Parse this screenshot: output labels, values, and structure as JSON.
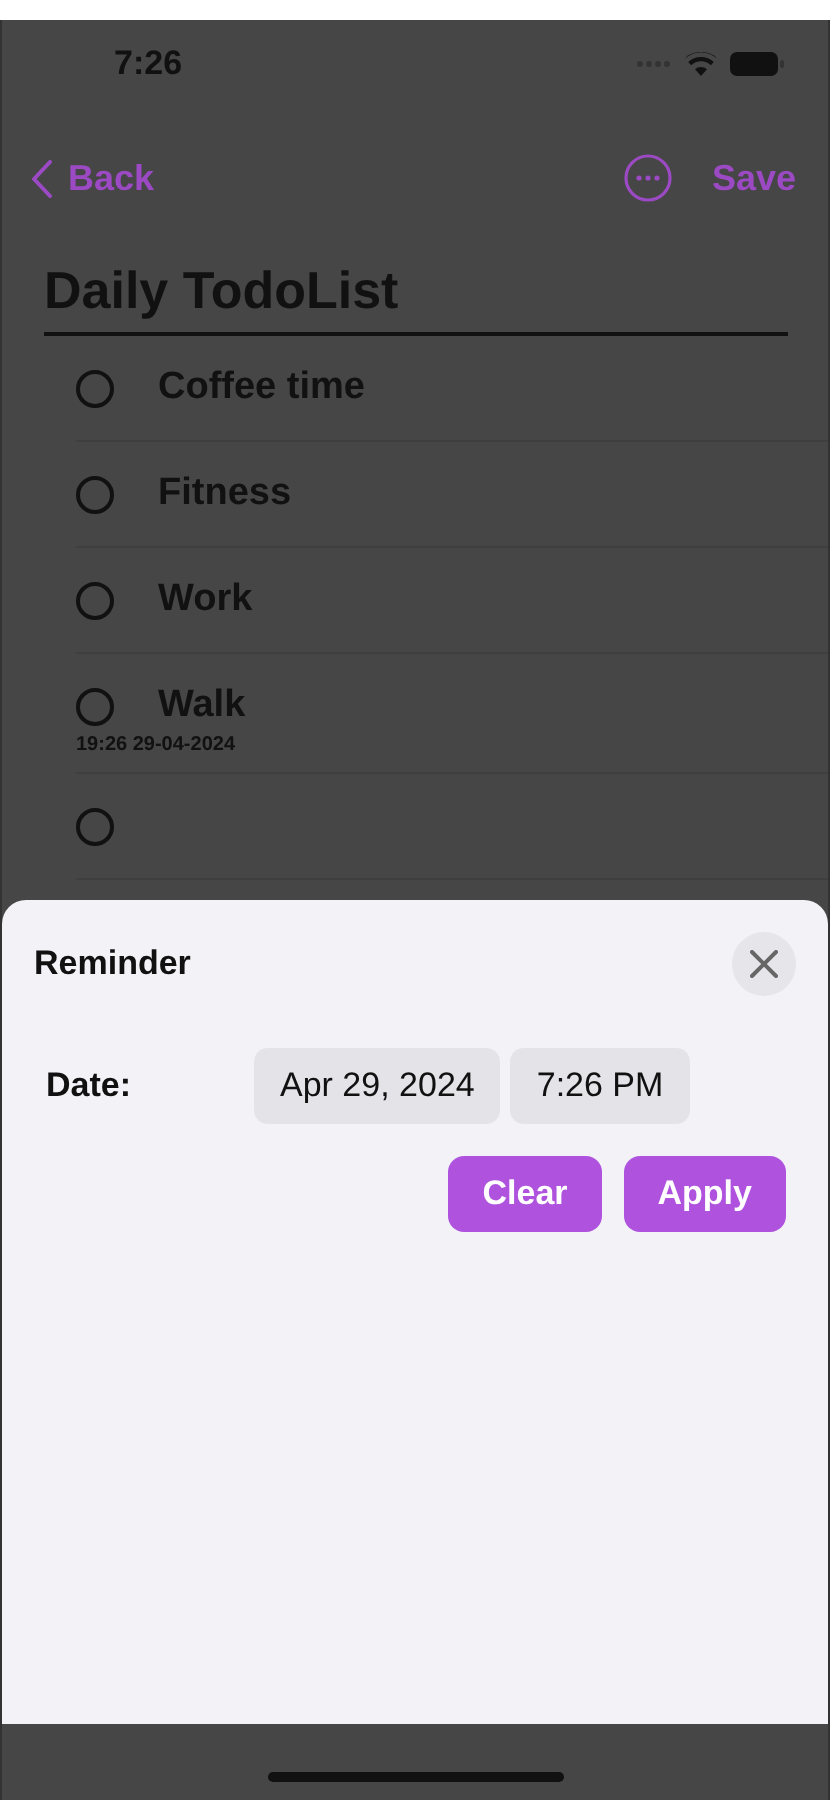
{
  "status_bar": {
    "time": "7:26"
  },
  "nav": {
    "back": "Back",
    "save": "Save"
  },
  "title": "Daily TodoList",
  "todos": [
    {
      "text": "Coffee time",
      "checked": false
    },
    {
      "text": "Fitness",
      "checked": false
    },
    {
      "text": "Work",
      "checked": false
    },
    {
      "text": "Walk",
      "checked": false,
      "note": "19:26 29-04-2024"
    },
    {
      "checked": false
    }
  ],
  "reminder": {
    "title": "Reminder",
    "date_label": "Date:",
    "date": "Apr 29, 2024",
    "time": "7:26 PM",
    "buttons": [
      "Clear",
      "Apply"
    ]
  }
}
